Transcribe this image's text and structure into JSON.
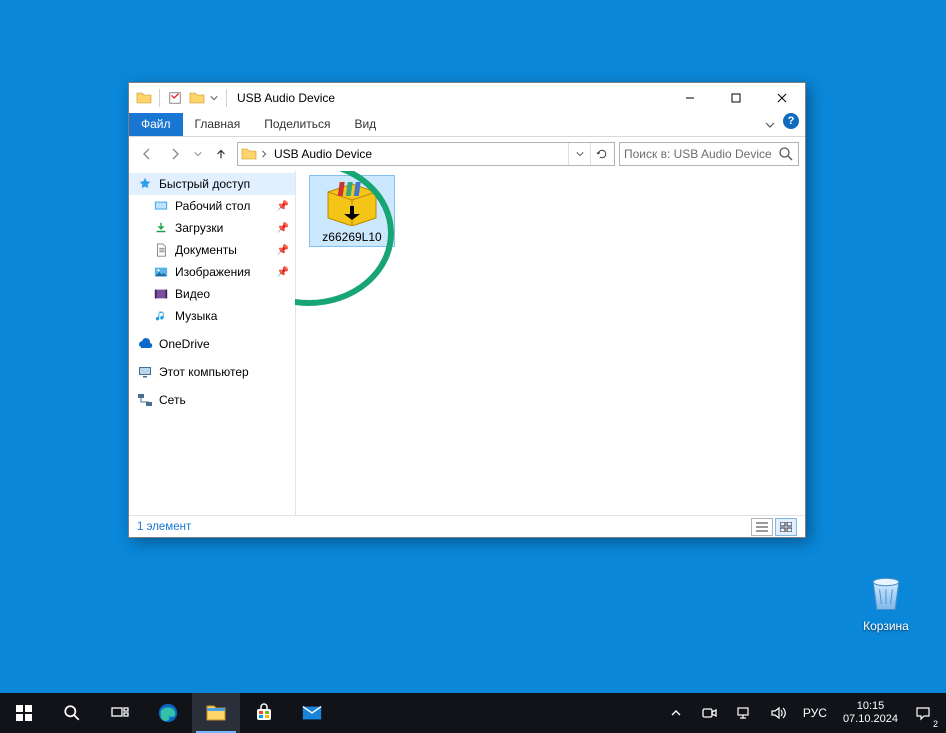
{
  "desktop": {
    "recycle_bin_label": "Корзина"
  },
  "window": {
    "title": "USB Audio Device",
    "tabs": {
      "file": "Файл",
      "home": "Главная",
      "share": "Поделиться",
      "view": "Вид"
    },
    "address": {
      "crumb": "USB Audio Device"
    },
    "search": {
      "placeholder": "Поиск в: USB Audio Device"
    },
    "nav": {
      "quick_access": "Быстрый доступ",
      "desktop": "Рабочий стол",
      "downloads": "Загрузки",
      "documents": "Документы",
      "pictures": "Изображения",
      "videos": "Видео",
      "music": "Музыка",
      "onedrive": "OneDrive",
      "this_pc": "Этот компьютер",
      "network": "Сеть"
    },
    "content": {
      "file_name": "z66269L10"
    },
    "status": {
      "count_text": "1 элемент"
    }
  },
  "taskbar": {
    "language": "РУС",
    "time": "10:15",
    "date": "07.10.2024",
    "notification_count": "2"
  }
}
